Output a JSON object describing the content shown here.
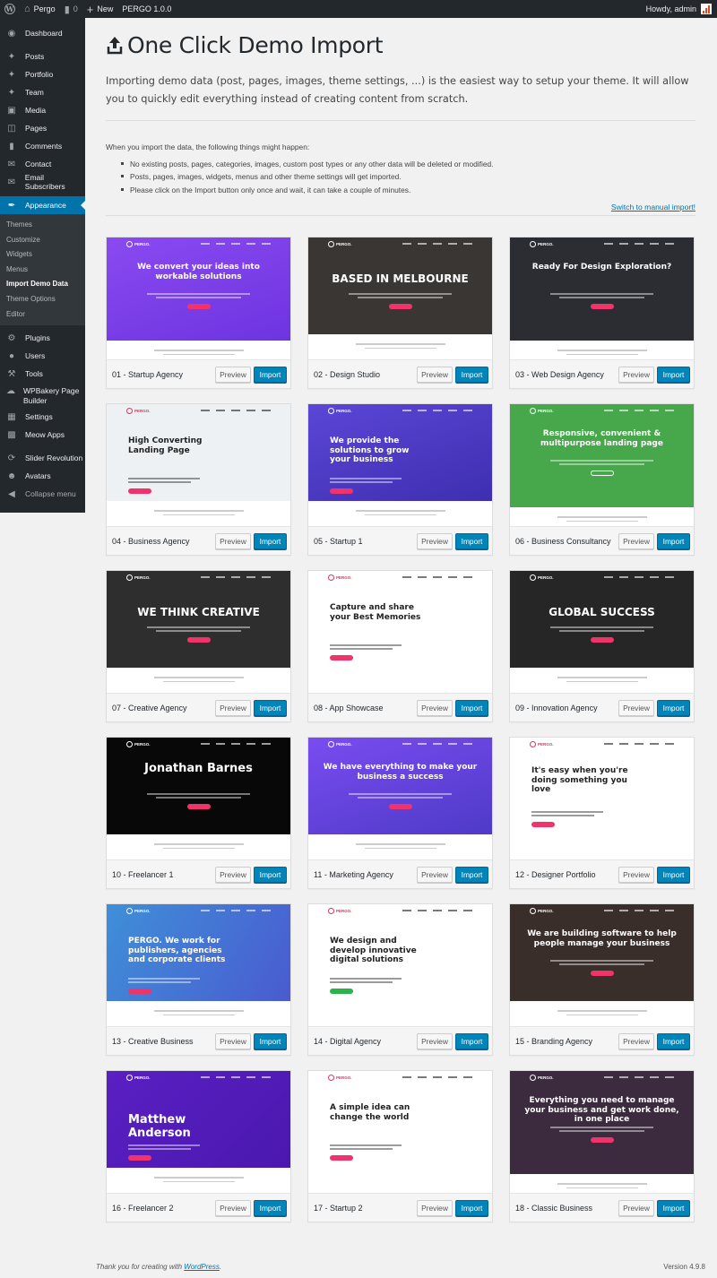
{
  "adminbar": {
    "site_name": "Pergo",
    "comments_count": "0",
    "new_label": "New",
    "theme_label": "PERGO 1.0.0",
    "howdy": "Howdy, admin"
  },
  "sidebar": {
    "items": [
      {
        "label": "Dashboard",
        "icon": "dashboard-icon"
      },
      {
        "label": "Posts",
        "icon": "pin-icon"
      },
      {
        "label": "Portfolio",
        "icon": "pin-icon"
      },
      {
        "label": "Team",
        "icon": "pin-icon"
      },
      {
        "label": "Media",
        "icon": "media-icon"
      },
      {
        "label": "Pages",
        "icon": "pages-icon"
      },
      {
        "label": "Comments",
        "icon": "comment-icon"
      },
      {
        "label": "Contact",
        "icon": "mail-icon"
      },
      {
        "label": "Email Subscribers",
        "icon": "mail-icon"
      },
      {
        "label": "Appearance",
        "icon": "brush-icon"
      },
      {
        "label": "Plugins",
        "icon": "plugin-icon"
      },
      {
        "label": "Users",
        "icon": "user-icon"
      },
      {
        "label": "Tools",
        "icon": "wrench-icon"
      },
      {
        "label": "WPBakery Page Builder",
        "icon": "cloud-icon"
      },
      {
        "label": "Settings",
        "icon": "settings-icon"
      },
      {
        "label": "Meow Apps",
        "icon": "camera-icon"
      },
      {
        "label": "Slider Revolution",
        "icon": "refresh-icon"
      },
      {
        "label": "Avatars",
        "icon": "avatar-icon"
      },
      {
        "label": "Collapse menu",
        "icon": "collapse-icon"
      }
    ],
    "appearance_submenu": [
      "Themes",
      "Customize",
      "Widgets",
      "Menus",
      "Import Demo Data",
      "Theme Options",
      "Editor"
    ],
    "current_submenu": "Import Demo Data"
  },
  "page": {
    "title": "One Click Demo Import",
    "intro": "Importing demo data (post, pages, images, theme settings, ...) is the easiest way to setup your theme. It will allow you to quickly edit everything instead of creating content from scratch.",
    "notice_head": "When you import the data, the following things might happen:",
    "notes": [
      "No existing posts, pages, categories, images, custom post types or any other data will be deleted or modified.",
      "Posts, pages, images, widgets, menus and other theme settings will get imported.",
      "Please click on the Import button only once and wait, it can take a couple of minutes."
    ],
    "switch_link": "Switch to manual import!",
    "preview_label": "Preview",
    "import_label": "Import"
  },
  "demos": [
    {
      "name": "01 - Startup Agency",
      "headline": "We convert your ideas into workable solutions",
      "bg": "#7b3fe4"
    },
    {
      "name": "02 - Design Studio",
      "headline": "BASED IN MELBOURNE",
      "bg": "#3a3634"
    },
    {
      "name": "03 - Web Design Agency",
      "headline": "Ready For Design Exploration?",
      "bg": "#2b2d33"
    },
    {
      "name": "04 - Business Agency",
      "headline": "High Converting Landing Page",
      "bg": "#eef1f4"
    },
    {
      "name": "05 - Startup 1",
      "headline": "We provide the solutions to grow your business",
      "bg": "#4f3fc9"
    },
    {
      "name": "06 - Business Consultancy",
      "headline": "Responsive, convenient & multipurpose landing page",
      "bg": "#46a84a"
    },
    {
      "name": "07 - Creative Agency",
      "headline": "WE THINK CREATIVE",
      "bg": "#2e2e2e"
    },
    {
      "name": "08 - App Showcase",
      "headline": "Capture and share your Best Memories",
      "bg": "#ffffff"
    },
    {
      "name": "09 - Innovation Agency",
      "headline": "GLOBAL SUCCESS",
      "bg": "#262626"
    },
    {
      "name": "10 - Freelancer 1",
      "headline": "Jonathan Barnes",
      "bg": "#080808"
    },
    {
      "name": "11 - Marketing Agency",
      "headline": "We have everything to make your business a success",
      "bg": "#6a3fe0"
    },
    {
      "name": "12 - Designer Portfolio",
      "headline": "It's easy when you're doing something you love",
      "bg": "#ffffff"
    },
    {
      "name": "13 - Creative Business",
      "headline": "PERGO. We work for publishers, agencies and corporate clients",
      "bg": "#3f7fd8"
    },
    {
      "name": "14 - Digital Agency",
      "headline": "We design and develop innovative digital solutions",
      "bg": "#ffffff"
    },
    {
      "name": "15 - Branding Agency",
      "headline": "We are building software to help people manage your business",
      "bg": "#3a2e2a"
    },
    {
      "name": "16 - Freelancer 2",
      "headline": "Matthew Anderson",
      "bg": "#5a1fc2"
    },
    {
      "name": "17 - Startup 2",
      "headline": "A simple idea can change the world",
      "bg": "#ffffff"
    },
    {
      "name": "18 - Classic Business",
      "headline": "Everything you need to manage your business and get work done, in one place",
      "bg": "#3c2a3e"
    }
  ],
  "footer": {
    "thanks_prefix": "Thank you for creating with ",
    "wp_link": "WordPress",
    "thanks_suffix": ".",
    "version": "Version 4.9.8"
  },
  "colors": {
    "accent": "#0073aa",
    "button_primary": "#0085ba",
    "adminbar": "#23282d"
  }
}
